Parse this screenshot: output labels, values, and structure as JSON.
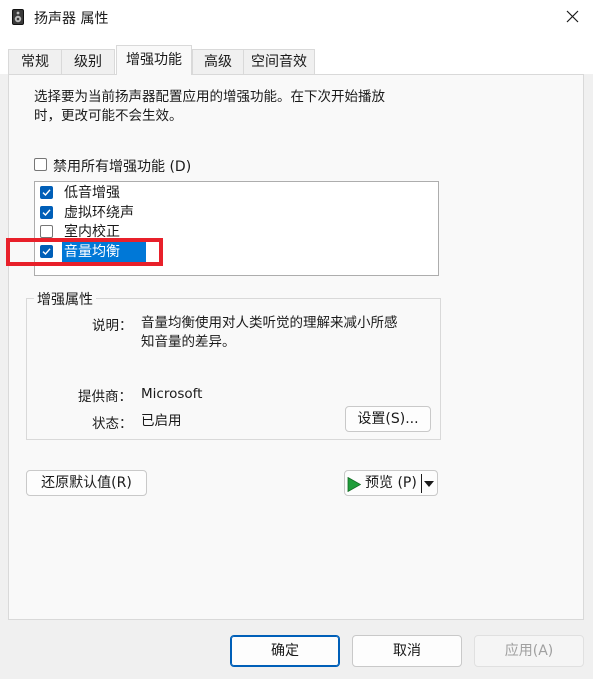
{
  "window": {
    "title": "扬声器 属性"
  },
  "tabs": [
    {
      "label": "常规"
    },
    {
      "label": "级别"
    },
    {
      "label": "增强功能"
    },
    {
      "label": "高级"
    },
    {
      "label": "空间音效"
    }
  ],
  "description": {
    "line1": "选择要为当前扬声器配置应用的增强功能。在下次开始播放",
    "line2": "时，更改可能不会生效。"
  },
  "disable_all": {
    "label": "禁用所有增强功能 (D)",
    "checked": false
  },
  "enhancements": [
    {
      "label": "低音增强",
      "checked": true
    },
    {
      "label": "虚拟环绕声",
      "checked": true
    },
    {
      "label": "室内校正",
      "checked": false
    },
    {
      "label": "音量均衡",
      "checked": true,
      "selected": true
    }
  ],
  "properties": {
    "group_title": "增强属性",
    "desc_label": "说明：",
    "desc_line1": "音量均衡使用对人类听觉的理解来减小所感",
    "desc_line2": "知音量的差异。",
    "provider_label": "提供商：",
    "provider_value": "Microsoft",
    "status_label": "状态：",
    "status_value": "已启用",
    "settings_button": "设置(S)..."
  },
  "restore_defaults_button": "还原默认值(R)",
  "preview_button": "预览 (P)",
  "footer": {
    "ok": "确定",
    "cancel": "取消",
    "apply": "应用(A)"
  },
  "colors": {
    "accent": "#005fb8",
    "selection": "#0078d7",
    "highlight_annotation": "#e8202a"
  }
}
